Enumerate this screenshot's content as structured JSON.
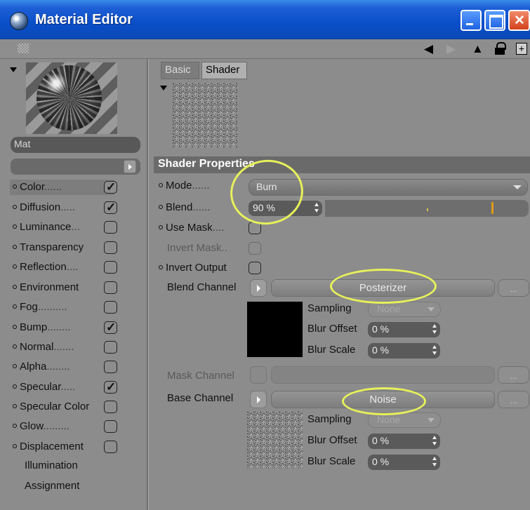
{
  "window": {
    "title": "Material Editor"
  },
  "material": {
    "name": "Mat"
  },
  "channels": [
    {
      "label": "Color",
      "dots": "......",
      "checked": true
    },
    {
      "label": "Diffusion",
      "dots": ".....",
      "checked": true
    },
    {
      "label": "Luminance",
      "dots": "...",
      "checked": false
    },
    {
      "label": "Transparency",
      "dots": "",
      "checked": false
    },
    {
      "label": "Reflection",
      "dots": "....",
      "checked": false
    },
    {
      "label": "Environment",
      "dots": "",
      "checked": false
    },
    {
      "label": "Fog",
      "dots": "..........",
      "checked": false
    },
    {
      "label": "Bump",
      "dots": "........",
      "checked": true
    },
    {
      "label": "Normal",
      "dots": ".......",
      "checked": false
    },
    {
      "label": "Alpha",
      "dots": "........",
      "checked": false
    },
    {
      "label": "Specular",
      "dots": ".....",
      "checked": true
    },
    {
      "label": "Specular Color",
      "dots": "",
      "checked": false
    },
    {
      "label": "Glow",
      "dots": ".........",
      "checked": false
    },
    {
      "label": "Displacement",
      "dots": "",
      "checked": false
    }
  ],
  "extra_items": [
    "Illumination",
    "Assignment"
  ],
  "tabs": {
    "basic": "Basic",
    "shader": "Shader"
  },
  "shader_properties": {
    "header": "Shader Properties",
    "mode_label": "Mode",
    "mode_dots": "......",
    "mode_value": "Burn",
    "blend_label": "Blend",
    "blend_dots": "......",
    "blend_value": "90 %",
    "use_mask_label": "Use Mask",
    "use_mask_dots": "....",
    "invert_mask_label": "Invert Mask",
    "invert_mask_dots": "..",
    "invert_output_label": "Invert Output",
    "blend_channel_label": "Blend Channel",
    "blend_channel_value": "Posterizer",
    "mask_channel_label": "Mask Channel",
    "base_channel_label": "Base Channel",
    "base_channel_value": "Noise",
    "more_button": "...",
    "sampling_label": "Sampling",
    "sampling_value": "None",
    "blur_offset_label": "Blur Offset",
    "blur_offset_value": "0 %",
    "blur_scale_label": "Blur Scale",
    "blur_scale_value": "0 %"
  },
  "colors": {
    "titlebar": "#0a4ec8",
    "panel": "#8c8c8c",
    "highlight_ellipse": "#e7f05a",
    "slider_marker": "#e09a1a"
  },
  "icons": [
    "material-icon",
    "minimize-icon",
    "maximize-icon",
    "close-icon",
    "grip-icon",
    "back-arrow-icon",
    "forward-arrow-icon",
    "up-arrow-icon",
    "lock-icon",
    "new-window-icon",
    "expand-triangle-icon"
  ]
}
